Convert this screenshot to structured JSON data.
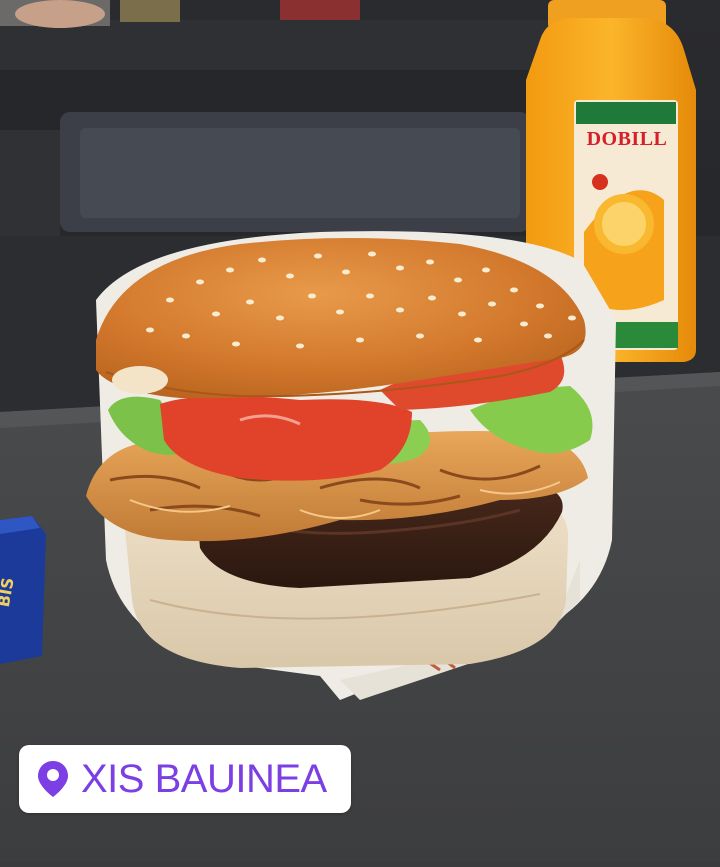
{
  "photo": {
    "subject": "burger-with-orange-juice-bottle",
    "bottle_brand": "DOBILL"
  },
  "location_sticker": {
    "label": "XIS BAUINEA",
    "icon": "location-pin-icon",
    "text_color": "#7b3fe4"
  }
}
